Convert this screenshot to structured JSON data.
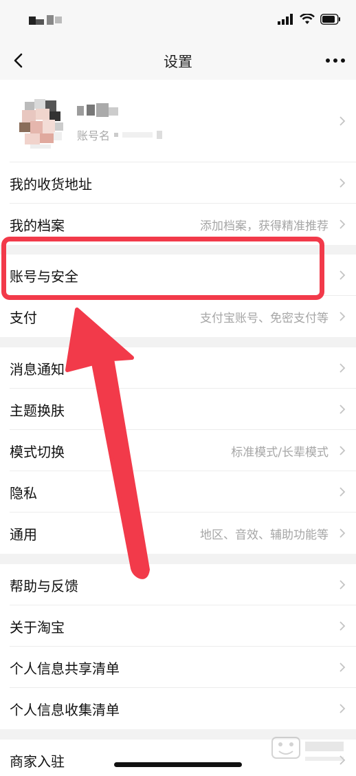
{
  "nav": {
    "title": "设置"
  },
  "profile": {
    "account_prefix": "账号名"
  },
  "group1": [
    {
      "label": "我的收货地址",
      "hint": ""
    },
    {
      "label": "我的档案",
      "hint": "添加档案，获得精准推荐"
    }
  ],
  "group2": [
    {
      "label": "账号与安全",
      "hint": ""
    },
    {
      "label": "支付",
      "hint": "支付宝账号、免密支付等"
    }
  ],
  "group3": [
    {
      "label": "消息通知",
      "hint": ""
    },
    {
      "label": "主题换肤",
      "hint": ""
    },
    {
      "label": "模式切换",
      "hint": "标准模式/长辈模式"
    },
    {
      "label": "隐私",
      "hint": ""
    },
    {
      "label": "通用",
      "hint": "地区、音效、辅助功能等"
    }
  ],
  "group4": [
    {
      "label": "帮助与反馈",
      "hint": ""
    },
    {
      "label": "关于淘宝",
      "hint": ""
    },
    {
      "label": "个人信息共享清单",
      "hint": ""
    },
    {
      "label": "个人信息收集清单",
      "hint": ""
    }
  ],
  "group5": [
    {
      "label": "商家入驻",
      "hint": ""
    }
  ],
  "colors": {
    "highlight": "#f23a4a",
    "hint_text": "#a6a6a6"
  }
}
